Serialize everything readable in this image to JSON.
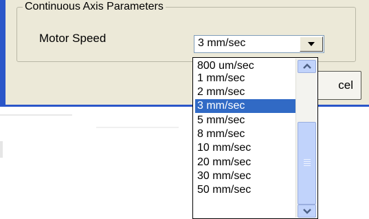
{
  "dialog": {
    "group_title": "Continuous Axis Parameters",
    "motor_speed_label": "Motor Speed",
    "motor_speed_value": "3 mm/sec",
    "cancel_label": "cel"
  },
  "dropdown": {
    "options": [
      "800 um/sec",
      "1 mm/sec",
      "2 mm/sec",
      "3 mm/sec",
      "5 mm/sec",
      "8 mm/sec",
      "10 mm/sec",
      "20 mm/sec",
      "30 mm/sec",
      "50 mm/sec"
    ],
    "selected_index": 3
  },
  "icons": {
    "combo_arrow": "chevron-down-icon",
    "scroll_up": "scroll-up-arrow-icon",
    "scroll_down": "scroll-down-arrow-icon"
  },
  "colors": {
    "selection": "#316ac5",
    "dialog_face": "#ece9d8",
    "window_frame": "#2a56c9"
  }
}
